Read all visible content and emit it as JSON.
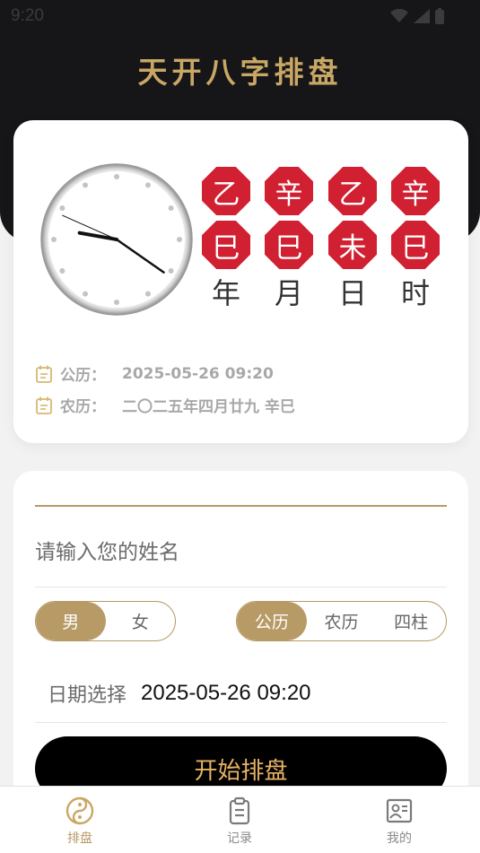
{
  "status_bar": {
    "time": "9:20",
    "icons": [
      "wifi-icon",
      "signal-icon",
      "battery-icon"
    ]
  },
  "app": {
    "title": "天开八字排盘"
  },
  "clock": {
    "hour": 9,
    "minute": 20,
    "second": 49
  },
  "pillars": [
    {
      "stem": "乙",
      "branch": "巳",
      "label": "年"
    },
    {
      "stem": "辛",
      "branch": "巳",
      "label": "月"
    },
    {
      "stem": "乙",
      "branch": "未",
      "label": "日"
    },
    {
      "stem": "辛",
      "branch": "巳",
      "label": "时"
    }
  ],
  "dates": {
    "solar_label": "公历：",
    "solar_value": "2025-05-26 09:20",
    "lunar_label": "农历：",
    "lunar_value": "二〇二五年四月廿九 辛巳"
  },
  "form": {
    "name_placeholder": "请输入您的姓名",
    "name_value": "",
    "gender_options": [
      "男",
      "女"
    ],
    "gender_selected": "男",
    "calendar_options": [
      "公历",
      "农历",
      "四柱"
    ],
    "calendar_selected": "公历",
    "date_label": "日期选择",
    "date_value": "2025-05-26 09:20",
    "start_button": "开始排盘"
  },
  "bottom_nav": [
    {
      "label": "排盘",
      "icon": "yin-yang-icon",
      "active": true
    },
    {
      "label": "记录",
      "icon": "clipboard-icon",
      "active": false
    },
    {
      "label": "我的",
      "icon": "profile-card-icon",
      "active": false
    }
  ],
  "colors": {
    "gold": "#b79a66",
    "title_gold": "#c9a765",
    "red": "#d02032",
    "dark": "#161518",
    "button_text": "#e6b264"
  }
}
